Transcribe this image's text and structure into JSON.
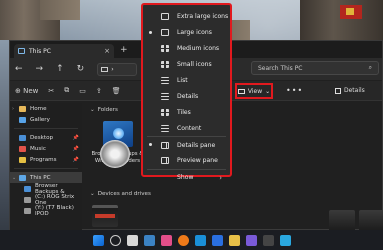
{
  "window": {
    "tab_title": "This PC",
    "new_tab": "+",
    "close_tab": "×"
  },
  "nav": {
    "back": "←",
    "forward": "→",
    "up": "↑",
    "refresh": "↻",
    "address_chevron": "›",
    "search_placeholder": "Search This PC",
    "search_icon": "⌕"
  },
  "toolbar": {
    "new": "⊕ New",
    "view_label": "View",
    "view_caret": "⌄",
    "more": "•••",
    "details_label": "Details",
    "items": [
      "✂",
      "⧉",
      "▭",
      "⇪",
      "🗑"
    ]
  },
  "sidebar": {
    "items": [
      {
        "label": "Home",
        "color": "#e6b85a",
        "pinned": false
      },
      {
        "label": "Gallery",
        "color": "#57a3e8",
        "pinned": false
      }
    ],
    "quick": [
      {
        "label": "Desktop",
        "color": "#4a8fd6",
        "pinned": true
      },
      {
        "label": "Music",
        "color": "#e2534a",
        "pinned": true
      },
      {
        "label": "Programs",
        "color": "#e5c043",
        "pinned": true
      }
    ],
    "drives": [
      {
        "label": "This PC",
        "color": "#5ea7e6",
        "selected": true
      },
      {
        "label": "Browser Backups &",
        "color": "#4a8fd6"
      },
      {
        "label": "(C:) ROG Strix One",
        "color": "#9a9a9a"
      },
      {
        "label": "(Y:) (T7 Black) IPOD",
        "color": "#9a9a9a"
      }
    ]
  },
  "main": {
    "folders_header": "Folders",
    "folder_tile_label": "Browser Backups & Windows Folders",
    "drives_header": "Devices and drives"
  },
  "menu": {
    "items": [
      {
        "label": "Extra large icons",
        "icon": "monitor-icon",
        "bullet": false
      },
      {
        "label": "Large icons",
        "icon": "monitor-icon",
        "bullet": true
      },
      {
        "label": "Medium icons",
        "icon": "grid-icon",
        "bullet": false
      },
      {
        "label": "Small icons",
        "icon": "grid-icon",
        "bullet": false
      },
      {
        "label": "List",
        "icon": "list-icon",
        "bullet": false
      },
      {
        "label": "Details",
        "icon": "list-icon",
        "bullet": false
      },
      {
        "label": "Tiles",
        "icon": "grid-icon",
        "bullet": false
      },
      {
        "label": "Content",
        "icon": "list-icon",
        "bullet": false
      },
      {
        "label": "Details pane",
        "icon": "pane-icon",
        "bullet": true
      },
      {
        "label": "Preview pane",
        "icon": "pane-icon",
        "bullet": false
      },
      {
        "label": "Show",
        "icon": "",
        "bullet": false,
        "submenu": true
      }
    ],
    "submenu_arrow": "›"
  },
  "colors": {
    "highlight": "#e1191e",
    "window_bg": "#202020",
    "menu_bg": "#2c2c2c"
  }
}
